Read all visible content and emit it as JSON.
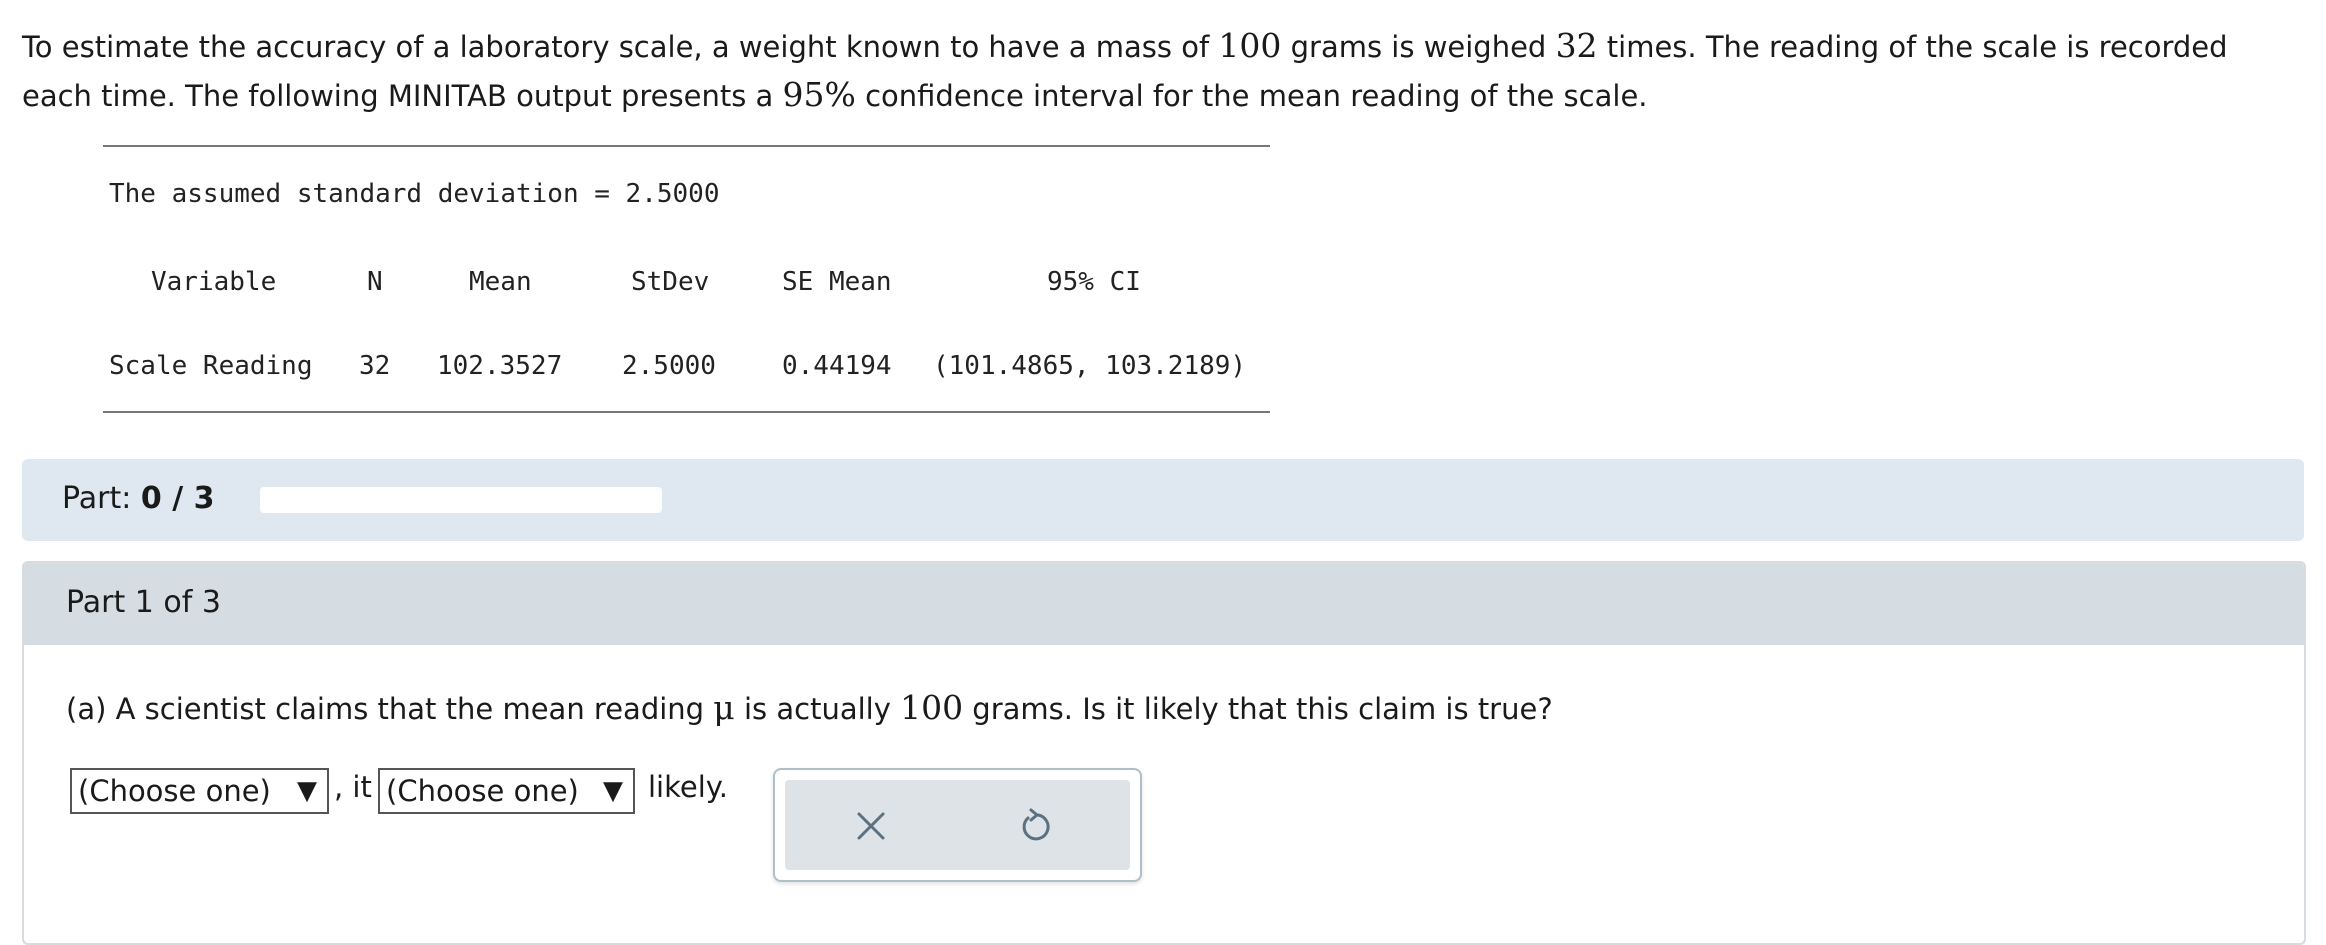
{
  "problem": {
    "text_1": "To estimate the accuracy of a laboratory scale, a weight known to have a mass of ",
    "mass": "100",
    "text_2": " grams is weighed ",
    "times": "32",
    "text_3": " times. The reading of the scale is recorded each time. The following MINITAB output presents a ",
    "confidence": "95%",
    "text_4": " confidence interval for the mean reading of the scale."
  },
  "minitab": {
    "assumed_sd_line": "The assumed standard deviation = 2.5000",
    "headers": [
      "Variable",
      "N",
      "Mean",
      "StDev",
      "SE Mean",
      "95% CI"
    ],
    "row": [
      "Scale Reading",
      "32",
      "102.3527",
      "2.5000",
      "0.44194",
      "(101.4865, 103.2189)"
    ]
  },
  "progress": {
    "label": "Part:",
    "value": "0 / 3",
    "fraction": 0
  },
  "part": {
    "title": "Part 1 of 3",
    "question_1": "(a) A scientist claims that the mean reading ",
    "mu": "μ",
    "question_2": " is actually ",
    "claim_value": "100",
    "question_3": " grams. Is it likely that this claim is true?",
    "dropdown_1": "(Choose one)",
    "separator": ", it",
    "dropdown_2": "(Choose one)",
    "suffix": "likely.",
    "dropdown_arrow": "▼"
  },
  "actions": {
    "clear_icon": "x-icon",
    "reset_icon": "undo-icon",
    "icon_color": "#5b7182"
  }
}
